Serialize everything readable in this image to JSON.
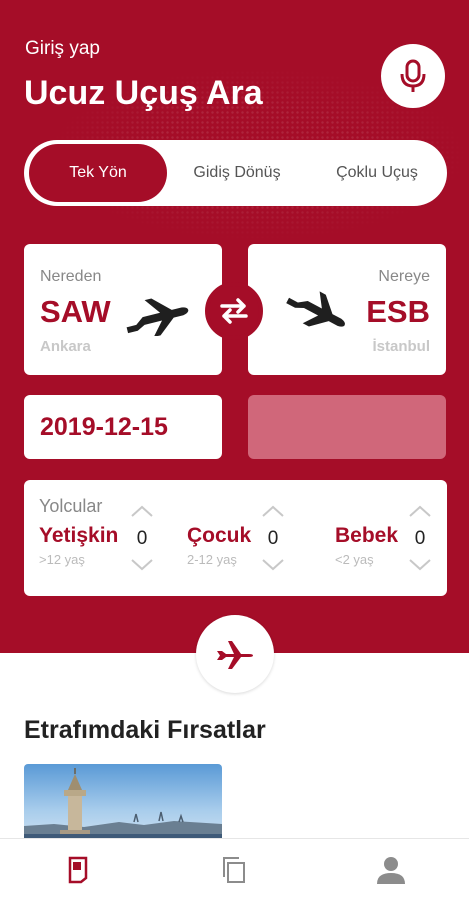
{
  "header": {
    "login_label": "Giriş yap",
    "title": "Ucuz Uçuş Ara",
    "mic_icon": "microphone-icon"
  },
  "trip_type": {
    "tabs": [
      {
        "label": "Tek Yön",
        "active": true
      },
      {
        "label": "Gidiş Dönüş",
        "active": false
      },
      {
        "label": "Çoklu Uçuş",
        "active": false
      }
    ]
  },
  "route": {
    "from": {
      "label": "Nereden",
      "code": "SAW",
      "city": "Ankara",
      "icon": "plane-takeoff-icon"
    },
    "to": {
      "label": "Nereye",
      "code": "ESB",
      "city": "İstanbul",
      "icon": "plane-landing-icon"
    },
    "swap_icon": "swap-arrows-icon"
  },
  "dates": {
    "departure": "2019-12-15",
    "return": ""
  },
  "passengers": {
    "title": "Yolcular",
    "groups": [
      {
        "label": "Yetişkin",
        "sub": ">12 yaş",
        "count": "0"
      },
      {
        "label": "Çocuk",
        "sub": "2-12 yaş",
        "count": "0"
      },
      {
        "label": "Bebek",
        "sub": "<2 yaş",
        "count": "0"
      }
    ]
  },
  "search_icon": "plane-icon",
  "deals": {
    "title": "Etrafımdaki Fırsatlar"
  },
  "bottom_nav": {
    "items": [
      "ticket-icon",
      "copy-icon",
      "person-icon"
    ]
  },
  "colors": {
    "brand": "#a50d28",
    "brand_light": "#d0677a"
  }
}
